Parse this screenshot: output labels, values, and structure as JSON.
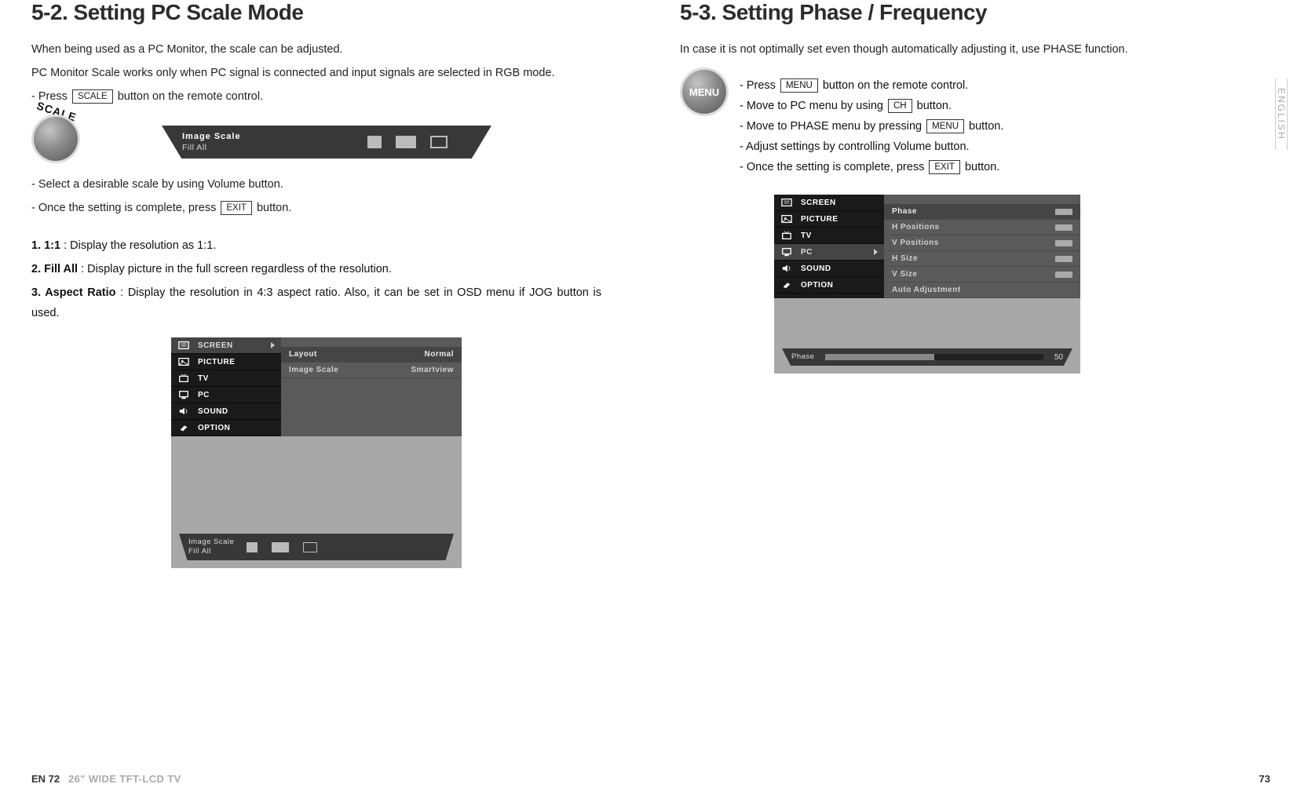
{
  "left": {
    "title": "5-2. Setting PC Scale Mode",
    "p1": "When being used as a PC Monitor, the scale can be adjusted.",
    "p2": "PC Monitor Scale works only when PC signal is connected and input signals are selected in RGB mode.",
    "press_prefix": "- Press ",
    "press_btn": "SCALE",
    "press_suffix": " button on the remote control.",
    "scale_btn_name": "SCALE",
    "scale_osd_title": "Image Scale",
    "scale_osd_value": "Fill  All",
    "step2": "- Select a desirable scale by using Volume button.",
    "step3a": "- Once the setting is complete, press ",
    "step3_btn": "EXIT",
    "step3b": " button.",
    "n1_label": "1. 1:1",
    "n1_text": " : Display the resolution as 1:1.",
    "n2_label": "2. Fill All",
    "n2_text": " : Display picture in the full screen regardless of the resolution.",
    "n3_label": "3. Aspect Ratio",
    "n3_text": " : Display the resolution in 4:3 aspect ratio. Also, it can be set in OSD menu if JOG button is used.",
    "osd": {
      "menu": [
        "SCREEN",
        "PICTURE",
        "TV",
        "PC",
        "SOUND",
        "OPTION"
      ],
      "active_index": 0,
      "sub": [
        {
          "label": "Layout",
          "value": "Normal"
        },
        {
          "label": "Image Scale",
          "value": "Smartview"
        }
      ],
      "strip_title": "Image Scale",
      "strip_value": "Fill  All"
    }
  },
  "right": {
    "title": "5-3. Setting Phase / Frequency",
    "intro": "In case it is not optimally set even though automatically adjusting it, use PHASE function.",
    "menu_btn_name": "MENU",
    "s1a": "- Press ",
    "s1_btn": "MENU",
    "s1b": " button on the remote control.",
    "s2a": "- Move to PC menu by using ",
    "s2_btn": "CH",
    "s2b": " button.",
    "s3a": "- Move to PHASE menu by pressing ",
    "s3_btn": "MENU",
    "s3b": " button.",
    "s4": "- Adjust settings by controlling Volume button.",
    "s5a": "- Once the setting is complete, press ",
    "s5_btn": "EXIT",
    "s5b": " button.",
    "osd": {
      "menu": [
        "SCREEN",
        "PICTURE",
        "TV",
        "PC",
        "SOUND",
        "OPTION"
      ],
      "active_index": 3,
      "sub": [
        {
          "label": "Phase",
          "slider": true,
          "hl": true
        },
        {
          "label": "H Positions",
          "slider": true
        },
        {
          "label": "V Positions",
          "slider": true
        },
        {
          "label": "H Size",
          "slider": true
        },
        {
          "label": "V Size",
          "slider": true
        },
        {
          "label": "Auto Adjustment",
          "slider": false
        }
      ],
      "strip_label": "Phase",
      "strip_value": "50"
    }
  },
  "chart_data": {
    "type": "bar",
    "title": "Phase",
    "categories": [
      "Phase"
    ],
    "values": [
      50
    ],
    "ylim": [
      0,
      100
    ],
    "xlabel": "",
    "ylabel": ""
  },
  "footer": {
    "left_page": "EN 72",
    "left_model": "26\" WIDE TFT-LCD TV",
    "right_page": "73",
    "side_tab": "ENGLISH"
  }
}
